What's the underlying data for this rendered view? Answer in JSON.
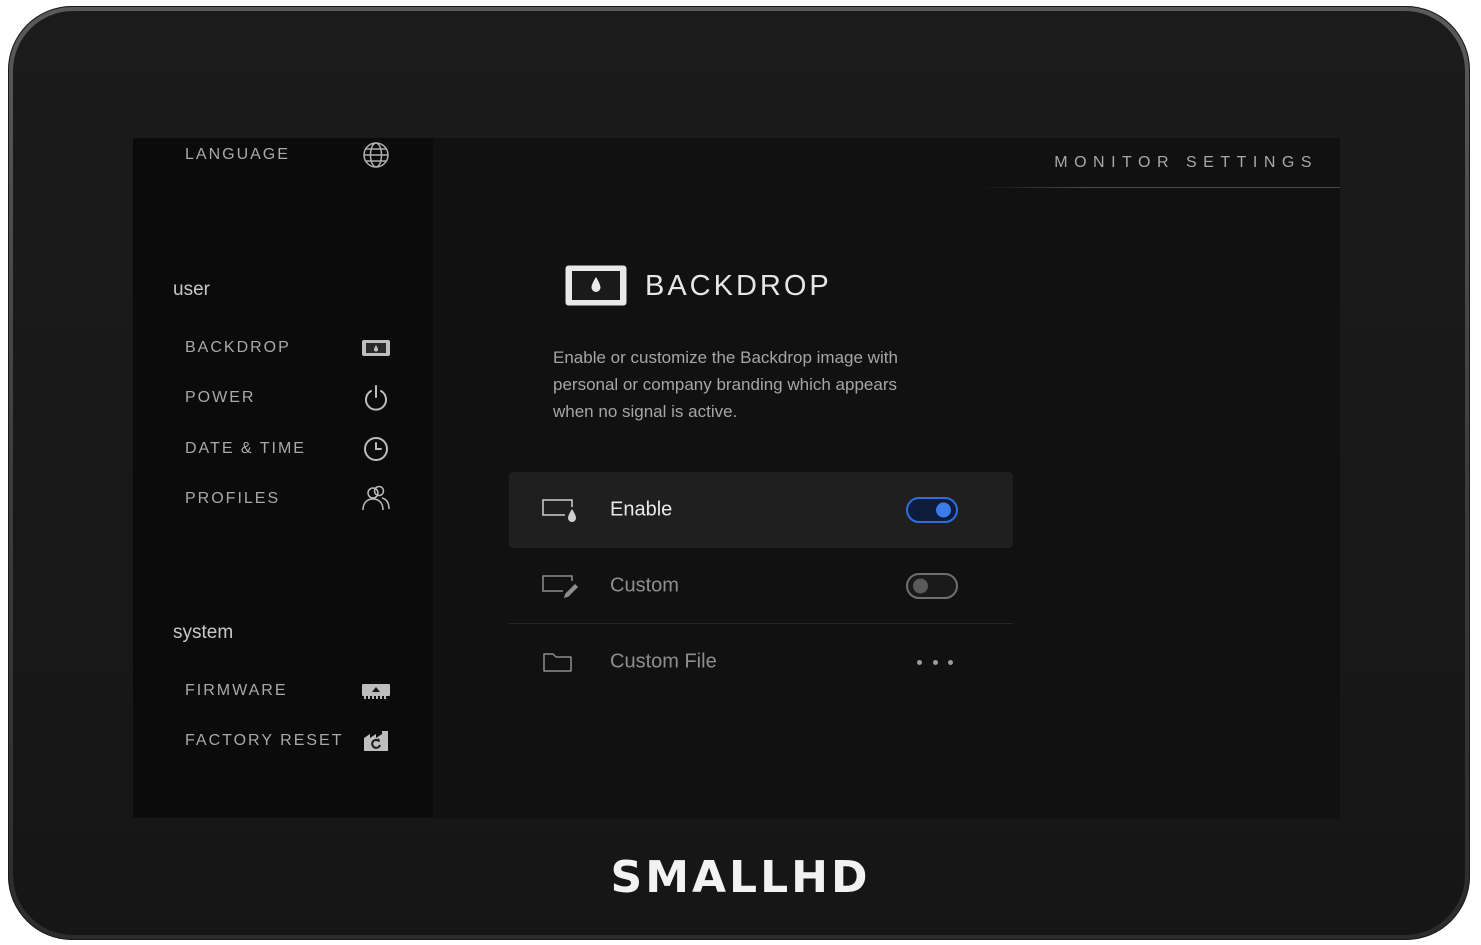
{
  "header": {
    "title": "MONITOR SETTINGS"
  },
  "sidebar": {
    "language": {
      "label": "LANGUAGE",
      "icon": "globe-icon"
    },
    "sections": {
      "user": {
        "label": "user"
      },
      "system": {
        "label": "system"
      }
    },
    "user_items": [
      {
        "label": "BACKDROP",
        "icon": "backdrop-icon"
      },
      {
        "label": "POWER",
        "icon": "power-icon"
      },
      {
        "label": "DATE & TIME",
        "icon": "clock-icon"
      },
      {
        "label": "PROFILES",
        "icon": "profiles-icon"
      }
    ],
    "system_items": [
      {
        "label": "FIRMWARE",
        "icon": "firmware-icon"
      },
      {
        "label": "FACTORY RESET",
        "icon": "factory-reset-icon"
      }
    ]
  },
  "page": {
    "title": "BACKDROP",
    "icon": "backdrop-icon",
    "description": "Enable or customize the Backdrop image with personal or company branding which appears when no signal is active."
  },
  "settings": [
    {
      "label": "Enable",
      "icon": "enable-backdrop-icon",
      "control": "toggle",
      "on": true,
      "selected": true
    },
    {
      "label": "Custom",
      "icon": "custom-edit-icon",
      "control": "toggle",
      "on": false,
      "selected": false
    },
    {
      "label": "Custom File",
      "icon": "folder-icon",
      "control": "more",
      "selected": false
    }
  ],
  "brand": {
    "name": "SMALLHD"
  },
  "colors": {
    "accent": "#3b7bea",
    "screen_bg": "#111111",
    "sidebar_bg": "#0b0b0b"
  }
}
